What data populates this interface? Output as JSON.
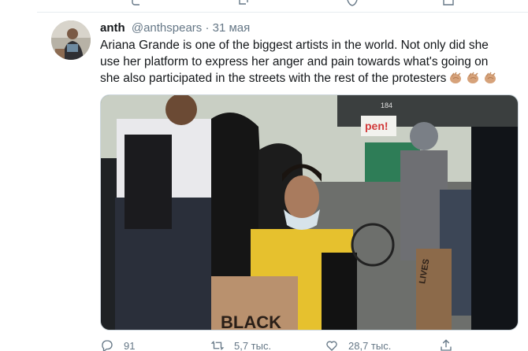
{
  "tweet": {
    "author_name": "anth",
    "author_handle": "@anthspears",
    "separator": "·",
    "date": "31 мая",
    "text": "Ariana Grande is one of the biggest artists in the world. Not only did she use her platform to express her anger and pain towards what's going on she also participated in the streets with the rest of the protesters",
    "emoji": [
      "clapping-hands-medium-skin-tone",
      "clapping-hands-medium-skin-tone",
      "clapping-hands-medium-skin-tone"
    ],
    "media": {
      "sign_text": "BLACK",
      "side_sign_text": "LIVES",
      "storefront_text": "pen!",
      "building_number": "184"
    },
    "actions": {
      "reply_count": "91",
      "retweet_count": "5,7 тыс.",
      "like_count": "28,7 тыс."
    }
  },
  "icons": {
    "reply": "reply-icon",
    "retweet": "retweet-icon",
    "like": "heart-icon",
    "share": "share-icon"
  },
  "colors": {
    "text": "#14171a",
    "secondary": "#657786",
    "divider": "#e6ecf0"
  }
}
